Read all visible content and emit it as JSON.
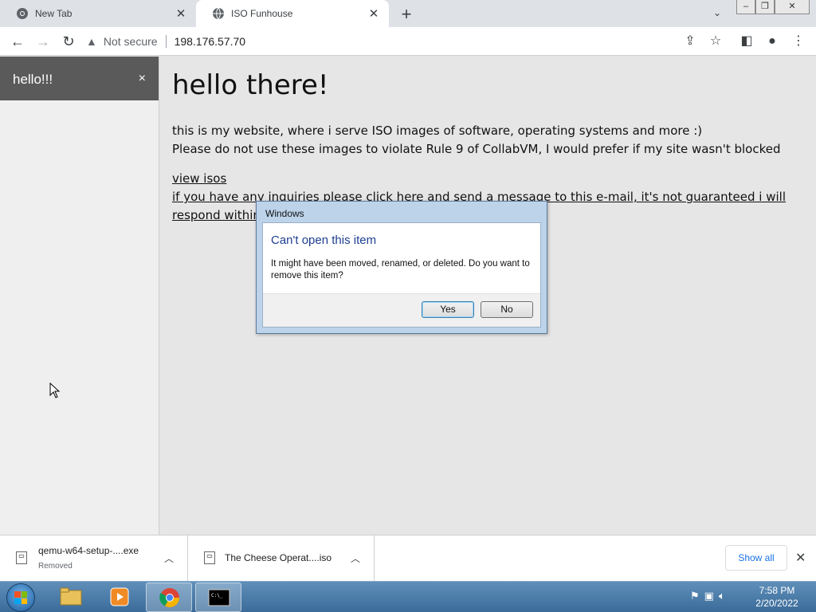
{
  "tabs": [
    {
      "title": "New Tab",
      "icon": "chrome-icon"
    },
    {
      "title": "ISO Funhouse",
      "icon": "globe-icon"
    }
  ],
  "address": {
    "security": "Not secure",
    "url": "198.176.57.70"
  },
  "sidebar": {
    "title": "hello!!!",
    "close": "×"
  },
  "page": {
    "heading": "hello there!",
    "line1": "this is my website, where i serve ISO images of software, operating systems and more :)",
    "line2": "Please do not use these images to violate Rule 9 of CollabVM, I would prefer if my site wasn't blocked",
    "link1": "view isos",
    "link2a": "if you have any inquiries please click here and send a message to this e-mail, it's not guaranteed i will",
    "link2b": "respond within"
  },
  "dialog": {
    "title": "Windows",
    "heading": "Can't open this item",
    "message": "It might have been moved, renamed, or deleted. Do you want to remove this item?",
    "yes": "Yes",
    "no": "No"
  },
  "downloads": [
    {
      "name": "qemu-w64-setup-....exe",
      "status": "Removed"
    },
    {
      "name": "The Cheese Operat....iso",
      "status": ""
    }
  ],
  "shelf": {
    "show_all": "Show all"
  },
  "clock": {
    "time": "7:58 PM",
    "date": "2/20/2022"
  },
  "colors": {
    "dialog_heading": "#1e3e8f",
    "link_blue": "#1a73e8",
    "taskbar": "#3b6b99"
  }
}
